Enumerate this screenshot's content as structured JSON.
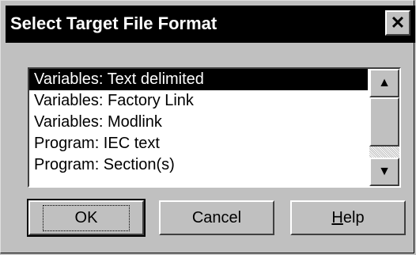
{
  "dialog": {
    "title": "Select Target File Format",
    "close_glyph": "✕"
  },
  "list": {
    "items": [
      {
        "label": "Variables: Text delimited",
        "selected": true
      },
      {
        "label": "Variables: Factory Link",
        "selected": false
      },
      {
        "label": "Variables: Modlink",
        "selected": false
      },
      {
        "label": "Program: IEC text",
        "selected": false
      },
      {
        "label": "Program: Section(s)",
        "selected": false
      }
    ],
    "scroll_up_glyph": "▲",
    "scroll_down_glyph": "▼"
  },
  "buttons": {
    "ok": "OK",
    "cancel": "Cancel",
    "help_prefix": "H",
    "help_rest": "elp"
  }
}
